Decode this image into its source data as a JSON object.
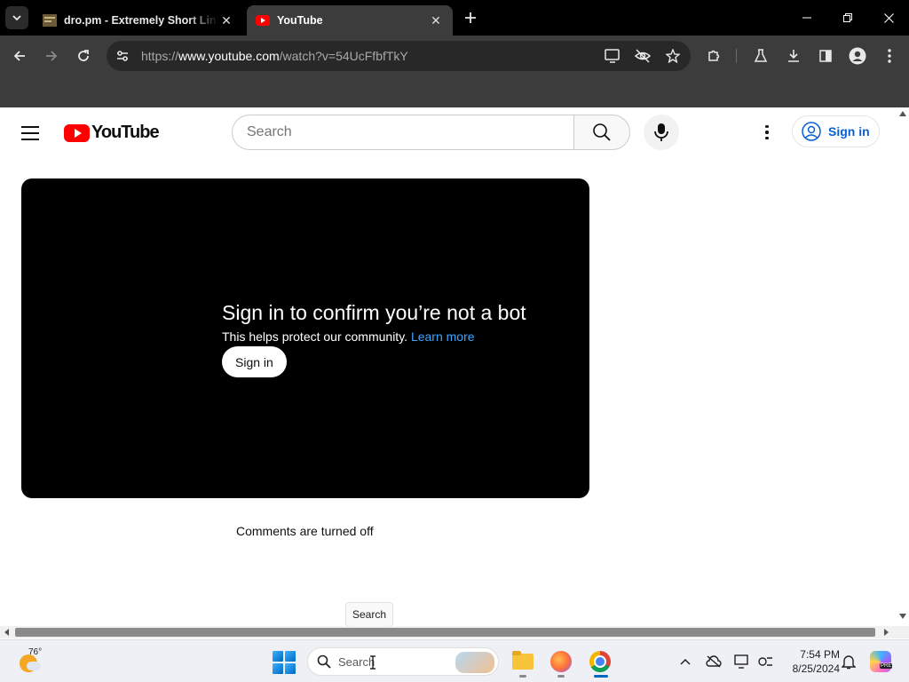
{
  "browser": {
    "tabs": [
      {
        "title": "dro.pm - Extremely Short Link",
        "active": false
      },
      {
        "title": "YouTube",
        "active": true
      }
    ],
    "url": {
      "scheme": "https://",
      "host": "www.youtube.com",
      "path": "/watch?v=54UcFfbfTkY"
    },
    "icons": {
      "back": "back-arrow-icon",
      "forward": "forward-arrow-icon",
      "reload": "reload-icon",
      "site_info": "tune-icon",
      "cast": "cast-icon",
      "eye_off": "eye-off-icon",
      "bookmark": "star-icon",
      "extensions": "puzzle-icon",
      "labs": "flask-icon",
      "downloads": "download-icon",
      "side_panel": "side-panel-icon",
      "profile": "profile-icon",
      "menu": "kebab-icon"
    }
  },
  "youtube": {
    "logo_text": "YouTube",
    "search_placeholder": "Search",
    "signin_label": "Sign in",
    "bot_check": {
      "title": "Sign in to confirm you’re not a bot",
      "subtitle": "This helps protect our community.",
      "learn_more": "Learn more",
      "button": "Sign in"
    },
    "comments_status": "Comments are turned off",
    "tooltip": "Search"
  },
  "taskbar": {
    "weather_temp": "76°",
    "search_placeholder": "Search",
    "time": "7:54 PM",
    "date": "8/25/2024"
  },
  "colors": {
    "yt_red": "#ff0000",
    "link_blue": "#065fd4",
    "learn_more_blue": "#3ea6ff",
    "chrome_dark": "#3c3c3c"
  }
}
